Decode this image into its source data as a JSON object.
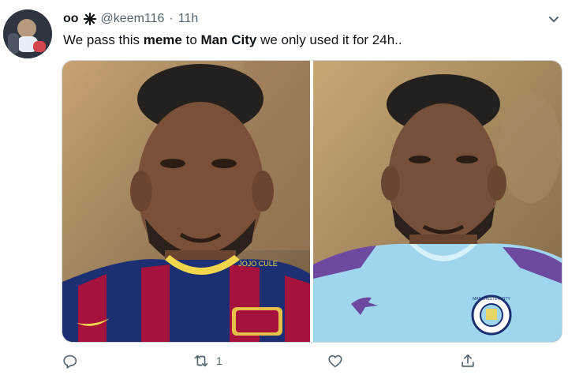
{
  "tweet": {
    "display_name": "oo",
    "handle": "@keem116",
    "separator": "·",
    "time": "11h",
    "text_parts": {
      "a": "We pass this ",
      "b": "meme",
      "c": " to ",
      "d": "Man City",
      "e": " we only used it for 24h.."
    }
  },
  "media": {
    "left": {
      "shirt_text": "JOJO CULE"
    },
    "right": {
      "shirt_text": "MANCHESTER CITY"
    }
  },
  "actions": {
    "reply_count": "",
    "retweet_count": "1",
    "like_count": "",
    "icons": [
      "reply-icon",
      "retweet-icon",
      "like-icon",
      "share-icon"
    ]
  },
  "colors": {
    "text": "#0f1419",
    "muted": "#536471",
    "border": "#cfd9de"
  }
}
